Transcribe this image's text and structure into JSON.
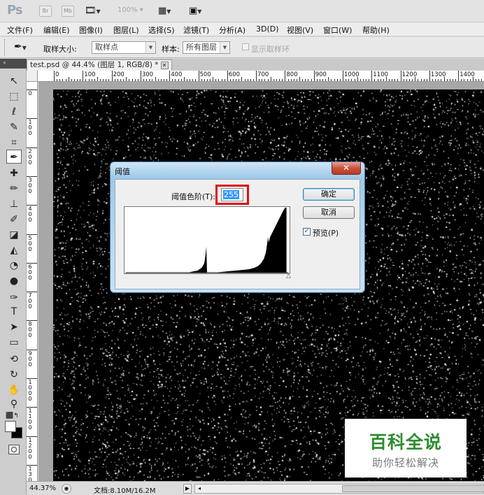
{
  "app": {
    "logo": "Ps",
    "title_buttons": [
      "Br",
      "Mb"
    ],
    "zoom_display": "100%"
  },
  "menu": {
    "items": [
      "文件(F)",
      "编辑(E)",
      "图像(I)",
      "图层(L)",
      "选择(S)",
      "滤镜(T)",
      "分析(A)",
      "3D(D)",
      "视图(V)",
      "窗口(W)",
      "帮助(H)"
    ]
  },
  "options_bar": {
    "sample_size_label": "取样大小:",
    "sample_size_value": "取样点",
    "sample_label": "样本:",
    "sample_value": "所有图层",
    "show_ring_label": "显示取样环"
  },
  "document_tab": {
    "title": "test.psd @ 44.4% (图层 1, RGB/8) *",
    "close": "✕"
  },
  "ruler": {
    "top_labels": [
      "0",
      "100",
      "200",
      "300",
      "400",
      "500",
      "600",
      "700",
      "800",
      "900",
      "1000",
      "1100",
      "1200",
      "1300",
      "1400"
    ],
    "left_labels": [
      "0",
      "100",
      "200",
      "300",
      "400",
      "500",
      "600",
      "700",
      "800",
      "900",
      "1000",
      "1100",
      "1200",
      "1300"
    ]
  },
  "dialog": {
    "title": "阈值",
    "close_label": "✕",
    "threshold_label": "阈值色阶(T):",
    "threshold_value": "255",
    "ok_label": "确定",
    "cancel_label": "取消",
    "preview_label": "预览(P)",
    "preview_checked": "✓",
    "slider_marker": "△"
  },
  "status": {
    "zoom": "44.37%",
    "doc_info": "文档:8.10M/16.2M",
    "menu_arrow": "▶"
  },
  "watermark": {
    "title": "百科全说",
    "subtitle": "助你轻松解决"
  },
  "colors": {
    "canvas": "#000000",
    "highlight": "#e01010",
    "selected_text": "#3399ff",
    "watermark_green": "#2e8b2e"
  }
}
